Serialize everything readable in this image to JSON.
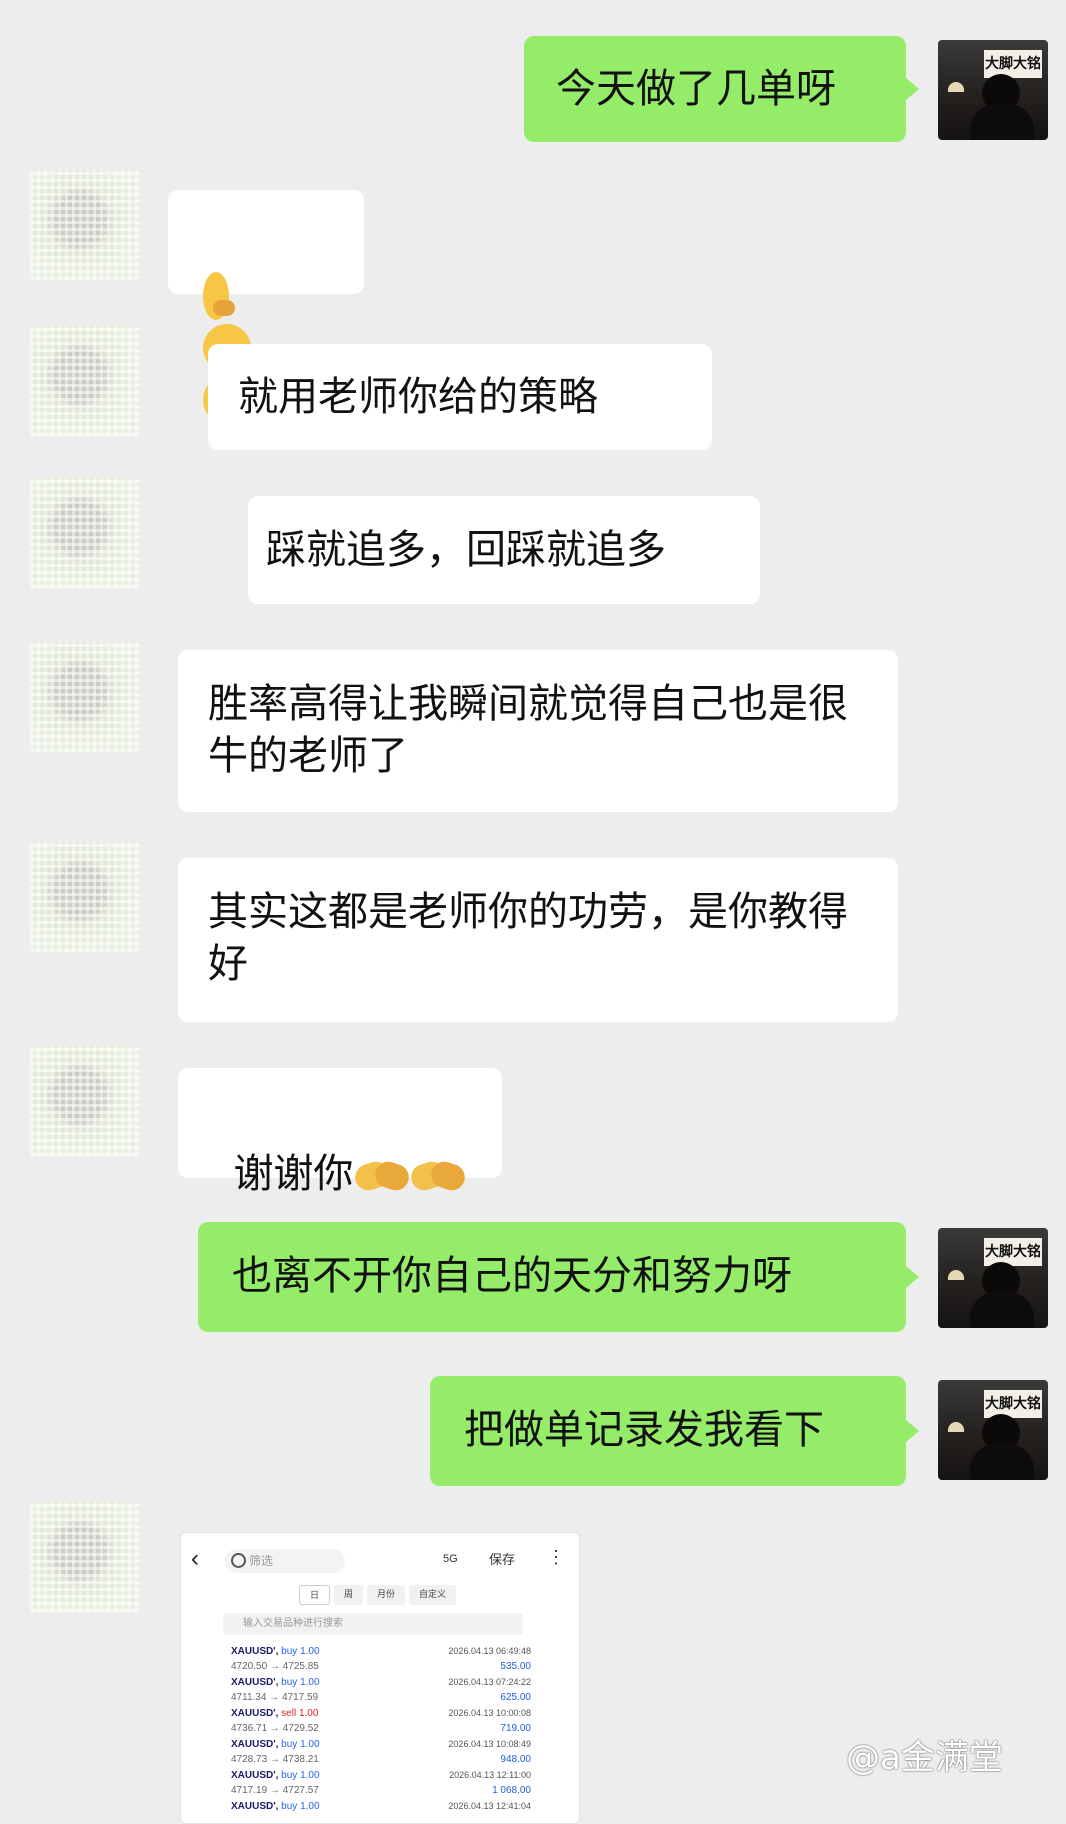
{
  "messages": {
    "m1": "今天做了几单呀",
    "m3": "就用老师你给的策略",
    "m4": "踩就追多，回踩就追多",
    "m5": "胜率高得让我瞬间就觉得自己也是很牛的老师了",
    "m6": "其实这都是老师你的功劳，是你教得好",
    "m7": "谢谢你",
    "m8": "也离不开你自己的天分和努力呀",
    "m9": "把做单记录发我看下"
  },
  "avatar_sign": "大脚大铭",
  "screenshot": {
    "search_placeholder": "筛选",
    "status": "5G",
    "save_label": "保存",
    "tabs": [
      "日",
      "周",
      "月份",
      "自定义"
    ],
    "filter_placeholder": "输入交易品种进行搜索",
    "rows": [
      {
        "symbol": "XAUUSD', ",
        "side": "buy 1.00",
        "prices": "4720.50 → 4725.85",
        "time": "2026.04.13 06:49:48",
        "profit": "535.00"
      },
      {
        "symbol": "XAUUSD', ",
        "side": "buy 1.00",
        "prices": "4711.34 → 4717.59",
        "time": "2026.04.13 07:24:22",
        "profit": "625.00"
      },
      {
        "symbol": "XAUUSD', ",
        "side": "sell 1.00",
        "prices": "4736.71 → 4729.52",
        "time": "2026.04.13 10:00:08",
        "profit": "719.00"
      },
      {
        "symbol": "XAUUSD', ",
        "side": "buy 1.00",
        "prices": "4728.73 → 4738.21",
        "time": "2026.04.13 10:08:49",
        "profit": "948.00"
      },
      {
        "symbol": "XAUUSD', ",
        "side": "buy 1.00",
        "prices": "4717.19 → 4727.57",
        "time": "2026.04.13 12:11:00",
        "profit": "1 068.00"
      },
      {
        "symbol": "XAUUSD', ",
        "side": "buy 1.00",
        "prices": "",
        "time": "2026.04.13 12:41:04",
        "profit": ""
      }
    ]
  },
  "watermark": "@a金满堂",
  "colors": {
    "background": "#ededed",
    "bubble_self": "#95ec69",
    "bubble_other": "#ffffff"
  }
}
